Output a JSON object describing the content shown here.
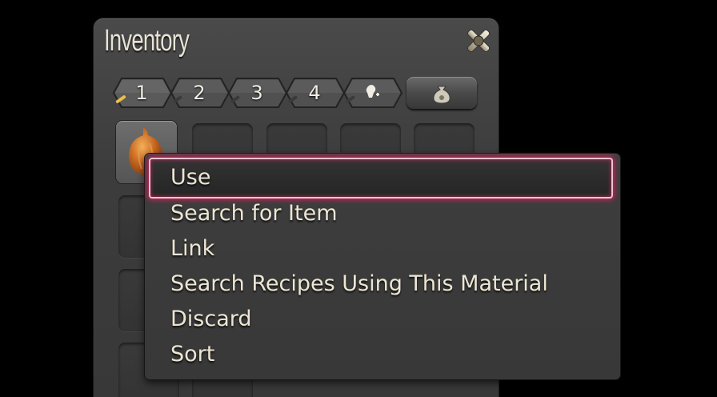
{
  "inventory": {
    "title": "Inventory",
    "tabs": [
      {
        "label": "1",
        "active": true
      },
      {
        "label": "2",
        "active": false
      },
      {
        "label": "3",
        "active": false
      },
      {
        "label": "4",
        "active": false
      },
      {
        "label": "",
        "icon": "key-items-icon",
        "active": false
      },
      {
        "label": "",
        "icon": "money-bag-icon",
        "active": false
      }
    ],
    "close_icon": "close-icon",
    "selected_item_icon": "onion-icon"
  },
  "context_menu": {
    "items": [
      {
        "label": "Use",
        "highlighted": true
      },
      {
        "label": "Search for Item"
      },
      {
        "label": "Link"
      },
      {
        "label": "Search Recipes Using This Material"
      },
      {
        "label": "Discard"
      },
      {
        "label": "Sort"
      }
    ],
    "highlight_color": "#c4245a"
  }
}
